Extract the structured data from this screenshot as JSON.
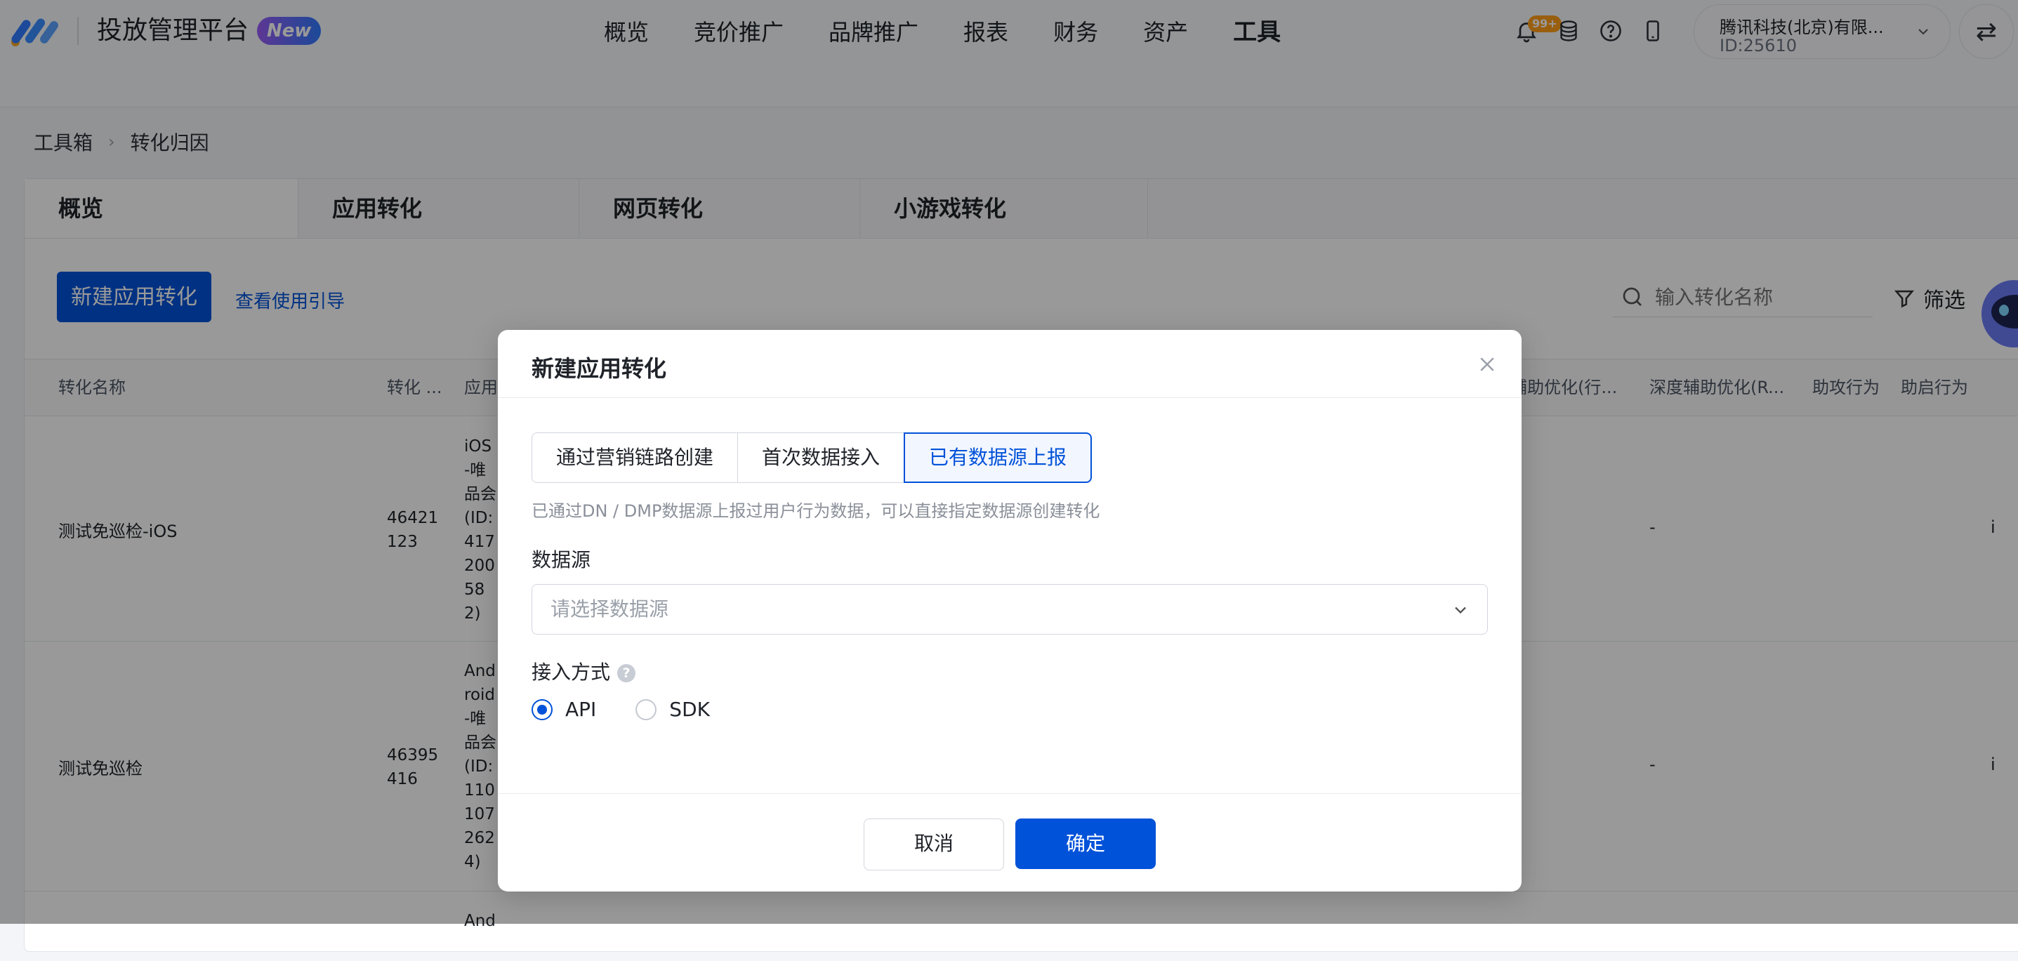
{
  "header": {
    "platform_title": "投放管理平台",
    "new_badge": "New",
    "nav": [
      "概览",
      "竞价推广",
      "品牌推广",
      "报表",
      "财务",
      "资产",
      "工具"
    ],
    "active_nav": "工具",
    "notification_count": "99+",
    "account_name": "腾讯科技(北京)有限...",
    "account_id": "ID:25610",
    "brand_color": "#0052d9"
  },
  "breadcrumb": [
    "工具箱",
    "转化归因"
  ],
  "tabs": [
    "概览",
    "应用转化",
    "网页转化",
    "小游戏转化"
  ],
  "toolbar": {
    "new_button": "新建应用转化",
    "guide_link": "查看使用引导",
    "search_placeholder": "输入转化名称",
    "filter_label": "筛选"
  },
  "table": {
    "columns": [
      "转化名称",
      "转化 ...",
      "应用",
      "辅助优化(行...",
      "深度辅助优化(R...",
      "助攻行为",
      "助启行为"
    ],
    "rows": [
      {
        "name": "测试免巡检-iOS",
        "id": "46421123",
        "app": "iOS-唯品会(ID:417 200 58 2)",
        "deep_assist": "-",
        "last": "i"
      },
      {
        "name": "测试免巡检",
        "id": "46395416",
        "app": "Android-唯品会(ID:110 107 262 4)",
        "deep_assist": "-",
        "last": "i"
      },
      {
        "name": "",
        "id": "",
        "app": "And",
        "deep_assist": "",
        "last": ""
      }
    ],
    "row1_id_lines": [
      "46421",
      "123"
    ],
    "row1_app_lines": [
      "iOS",
      "-唯",
      "品会",
      "(ID:",
      "417",
      "200",
      "58",
      "2)"
    ],
    "row2_id_lines": [
      "46395",
      "416"
    ],
    "row2_app_lines": [
      "And",
      "roid",
      "-唯",
      "品会",
      "(ID:",
      "110",
      "107",
      "262",
      "4)"
    ]
  },
  "modal": {
    "title": "新建应用转化",
    "segments": [
      "通过营销链路创建",
      "首次数据接入",
      "已有数据源上报"
    ],
    "active_segment": "已有数据源上报",
    "hint": "已通过DN / DMP数据源上报过用户行为数据，可以直接指定数据源创建转化",
    "datasource_label": "数据源",
    "datasource_placeholder": "请选择数据源",
    "access_label": "接入方式",
    "access_options": [
      "API",
      "SDK"
    ],
    "access_selected": "API",
    "cancel_label": "取消",
    "ok_label": "确定"
  }
}
